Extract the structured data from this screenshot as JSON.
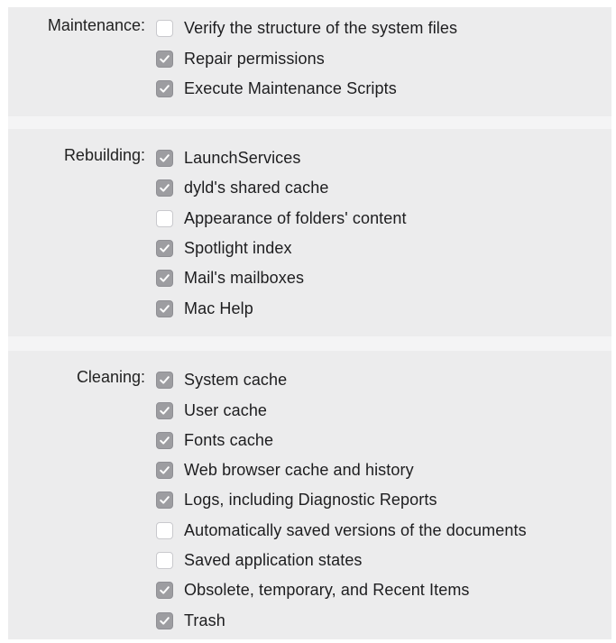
{
  "sections": [
    {
      "label": "Maintenance:",
      "items": [
        {
          "label": "Verify the structure of the system files",
          "checked": false
        },
        {
          "label": "Repair permissions",
          "checked": true
        },
        {
          "label": "Execute Maintenance Scripts",
          "checked": true
        }
      ]
    },
    {
      "label": "Rebuilding:",
      "items": [
        {
          "label": "LaunchServices",
          "checked": true
        },
        {
          "label": "dyld's shared cache",
          "checked": true
        },
        {
          "label": "Appearance of folders' content",
          "checked": false
        },
        {
          "label": "Spotlight index",
          "checked": true
        },
        {
          "label": "Mail's mailboxes",
          "checked": true
        },
        {
          "label": "Mac Help",
          "checked": true
        }
      ]
    },
    {
      "label": "Cleaning:",
      "items": [
        {
          "label": "System cache",
          "checked": true
        },
        {
          "label": "User cache",
          "checked": true
        },
        {
          "label": "Fonts cache",
          "checked": true
        },
        {
          "label": "Web browser cache and history",
          "checked": true
        },
        {
          "label": "Logs, including Diagnostic Reports",
          "checked": true
        },
        {
          "label": "Automatically saved versions of the documents",
          "checked": false
        },
        {
          "label": "Saved application states",
          "checked": false
        },
        {
          "label": "Obsolete, temporary, and Recent Items",
          "checked": true
        },
        {
          "label": "Trash",
          "checked": true
        }
      ]
    }
  ],
  "colors": {
    "checkbox_checked_fill": "#9d9da1",
    "checkbox_unchecked_fill": "#ffffff",
    "panel_background": "#ececed"
  }
}
